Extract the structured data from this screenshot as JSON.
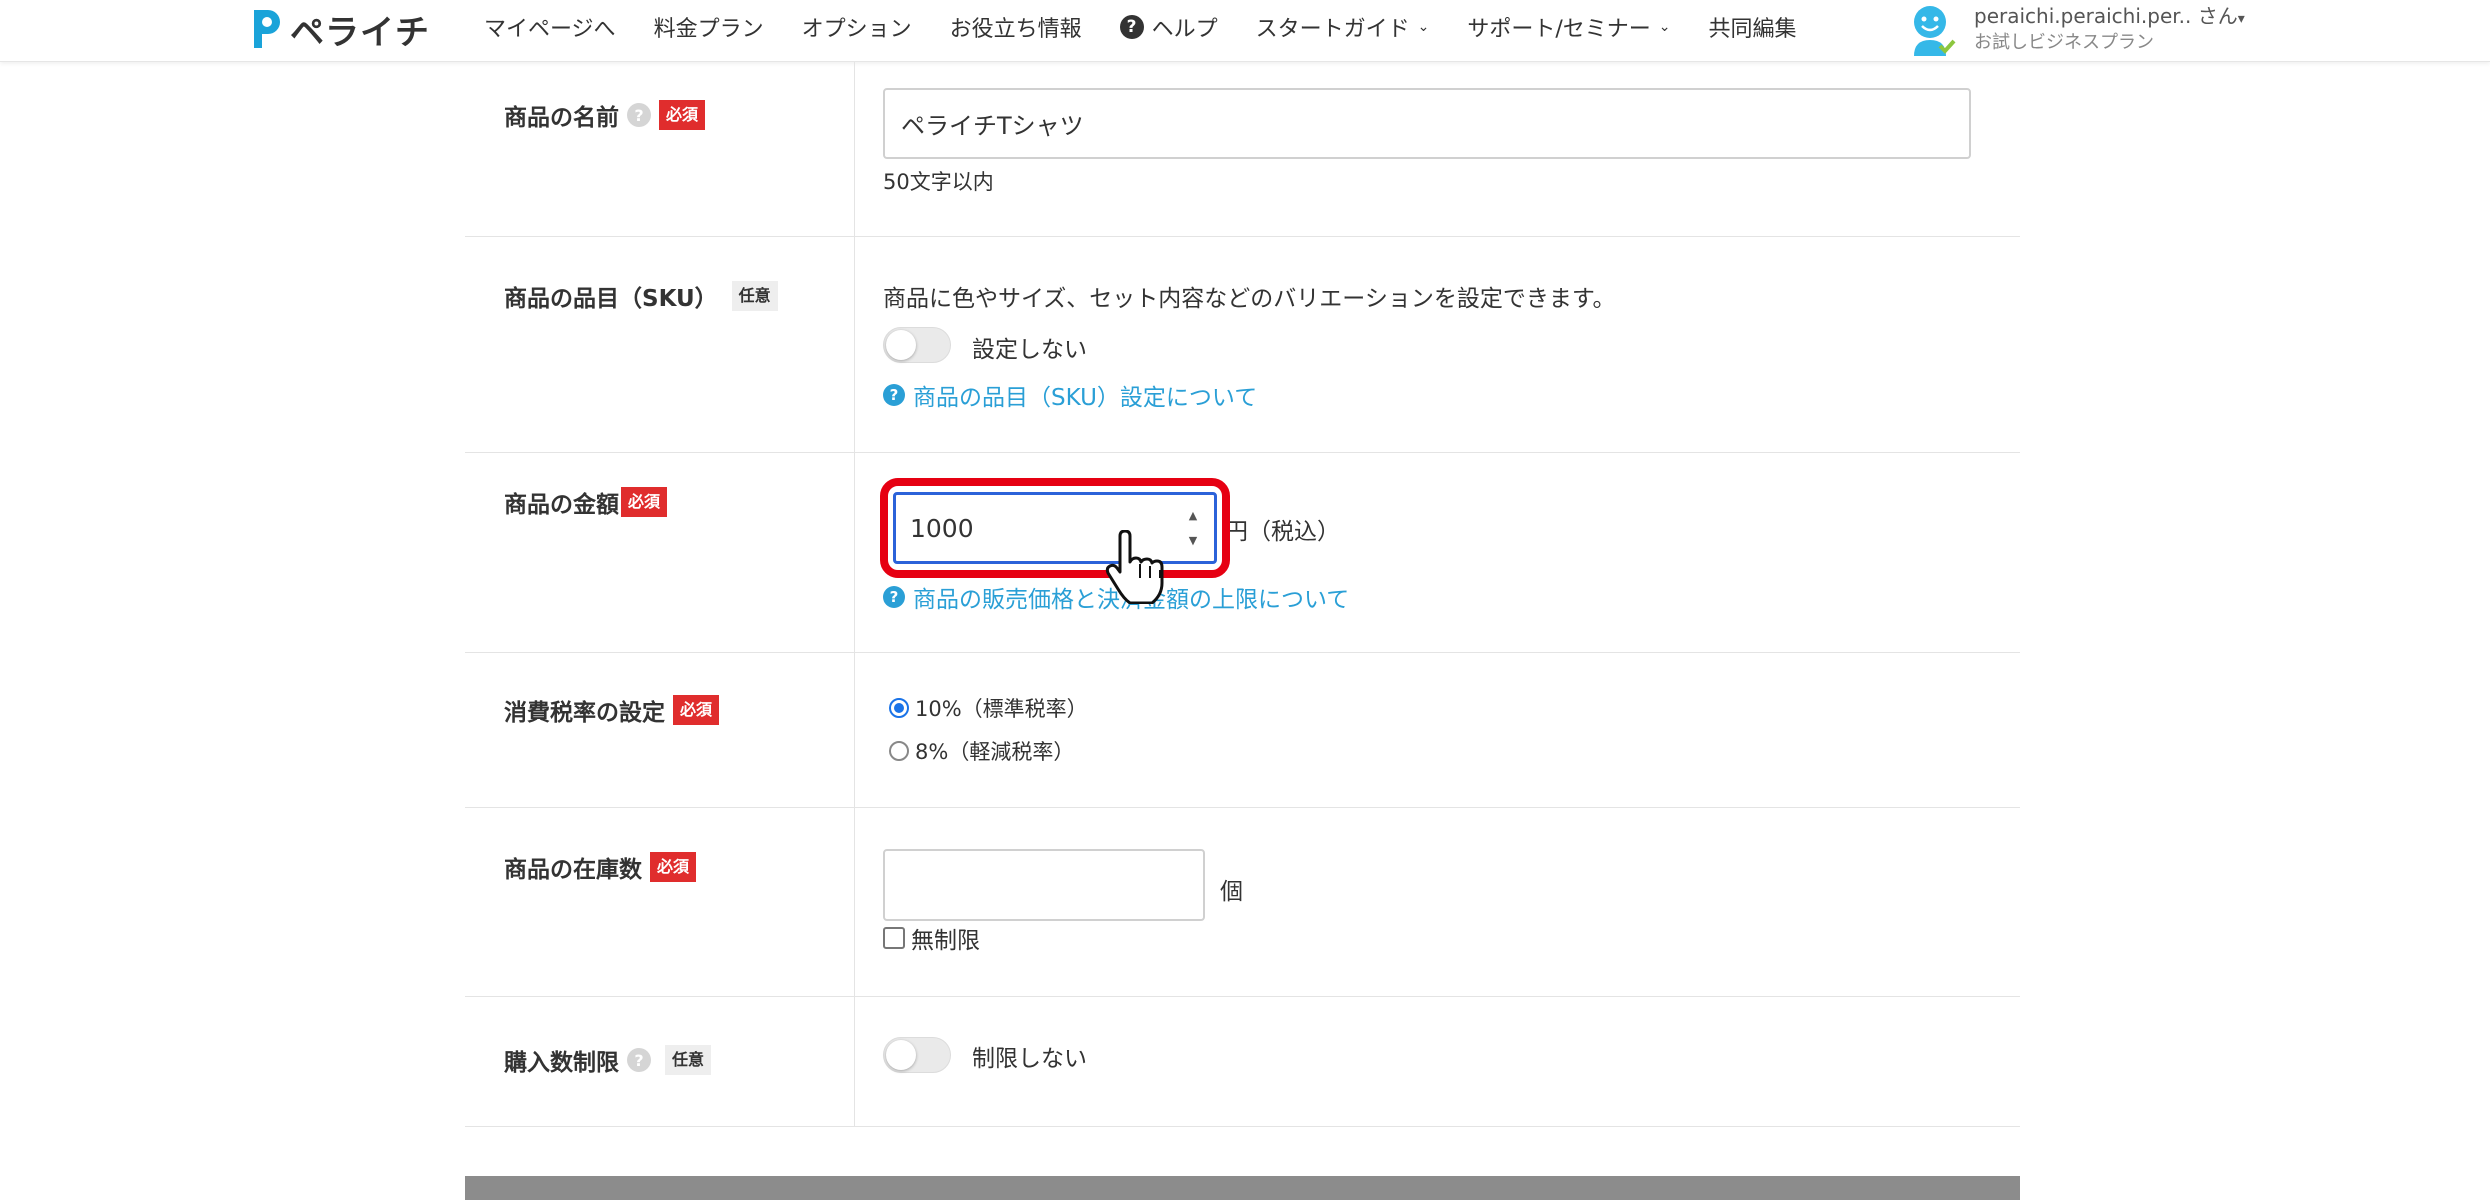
{
  "header": {
    "logo_text": "ペライチ",
    "nav": [
      {
        "label": "マイページへ"
      },
      {
        "label": "料金プラン"
      },
      {
        "label": "オプション"
      },
      {
        "label": "お役立ち情報"
      },
      {
        "label": "ヘルプ",
        "icon": "question-circle-icon"
      },
      {
        "label": "スタートガイド",
        "dropdown": true
      },
      {
        "label": "サポート/セミナー",
        "dropdown": true
      },
      {
        "label": "共同編集"
      }
    ],
    "user": {
      "name": "peraichi.peraichi.per.. さん",
      "plan": "お試しビジネスプラン"
    }
  },
  "badges": {
    "required": "必須",
    "optional": "任意"
  },
  "form": {
    "name": {
      "label": "商品の名前",
      "value": "ペライチTシャツ",
      "hint": "50文字以内"
    },
    "sku": {
      "label": "商品の品目（SKU）",
      "description": "商品に色やサイズ、セット内容などのバリエーションを設定できます。",
      "toggle_label": "設定しない",
      "help_link": "商品の品目（SKU）設定について"
    },
    "price": {
      "label": "商品の金額",
      "value": "1000",
      "unit": "円（税込）",
      "help_link": "商品の販売価格と決済金額の上限について"
    },
    "tax": {
      "label": "消費税率の設定",
      "options": [
        {
          "label": "10%（標準税率）",
          "selected": true
        },
        {
          "label": "8%（軽減税率）",
          "selected": false
        }
      ]
    },
    "stock": {
      "label": "商品の在庫数",
      "value": "",
      "unit": "個",
      "unlimited_label": "無制限"
    },
    "purchase_limit": {
      "label": "購入数制限",
      "toggle_label": "制限しない"
    }
  },
  "colors": {
    "required_badge": "#e02d2d",
    "link": "#2a9fd6",
    "focus_highlight": "#e60012",
    "input_focus": "#2b62d9",
    "logo": "#1aa3d9"
  }
}
